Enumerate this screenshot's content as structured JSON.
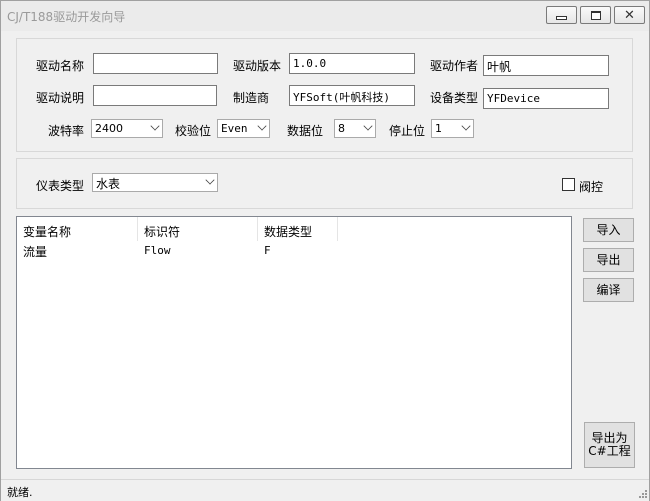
{
  "window": {
    "title": "CJ/T188驱动开发向导"
  },
  "driver_info": {
    "name_label": "驱动名称",
    "name_value": "",
    "version_label": "驱动版本",
    "version_value": "1.0.0",
    "author_label": "驱动作者",
    "author_value": "叶帆",
    "desc_label": "驱动说明",
    "desc_value": "",
    "maker_label": "制造商",
    "maker_value": "YFSoft(叶帆科技)",
    "devtype_label": "设备类型",
    "devtype_value": "YFDevice"
  },
  "serial": {
    "baud_label": "波特率",
    "baud_value": "2400",
    "parity_label": "校验位",
    "parity_value": "Even",
    "databits_label": "数据位",
    "databits_value": "8",
    "stopbits_label": "停止位",
    "stopbits_value": "1"
  },
  "meter": {
    "type_label": "仪表类型",
    "type_value": "水表",
    "valve_label": "阀控",
    "valve_checked": false
  },
  "variables": {
    "columns": [
      "变量名称",
      "标识符",
      "数据类型"
    ],
    "rows": [
      {
        "name": "流量",
        "id": "Flow",
        "type": "F"
      }
    ]
  },
  "buttons": {
    "import": "导入",
    "export": "导出",
    "compile": "编译",
    "export_cs_line1": "导出为",
    "export_cs_line2": "C#工程"
  },
  "status": {
    "text": "就绪."
  }
}
